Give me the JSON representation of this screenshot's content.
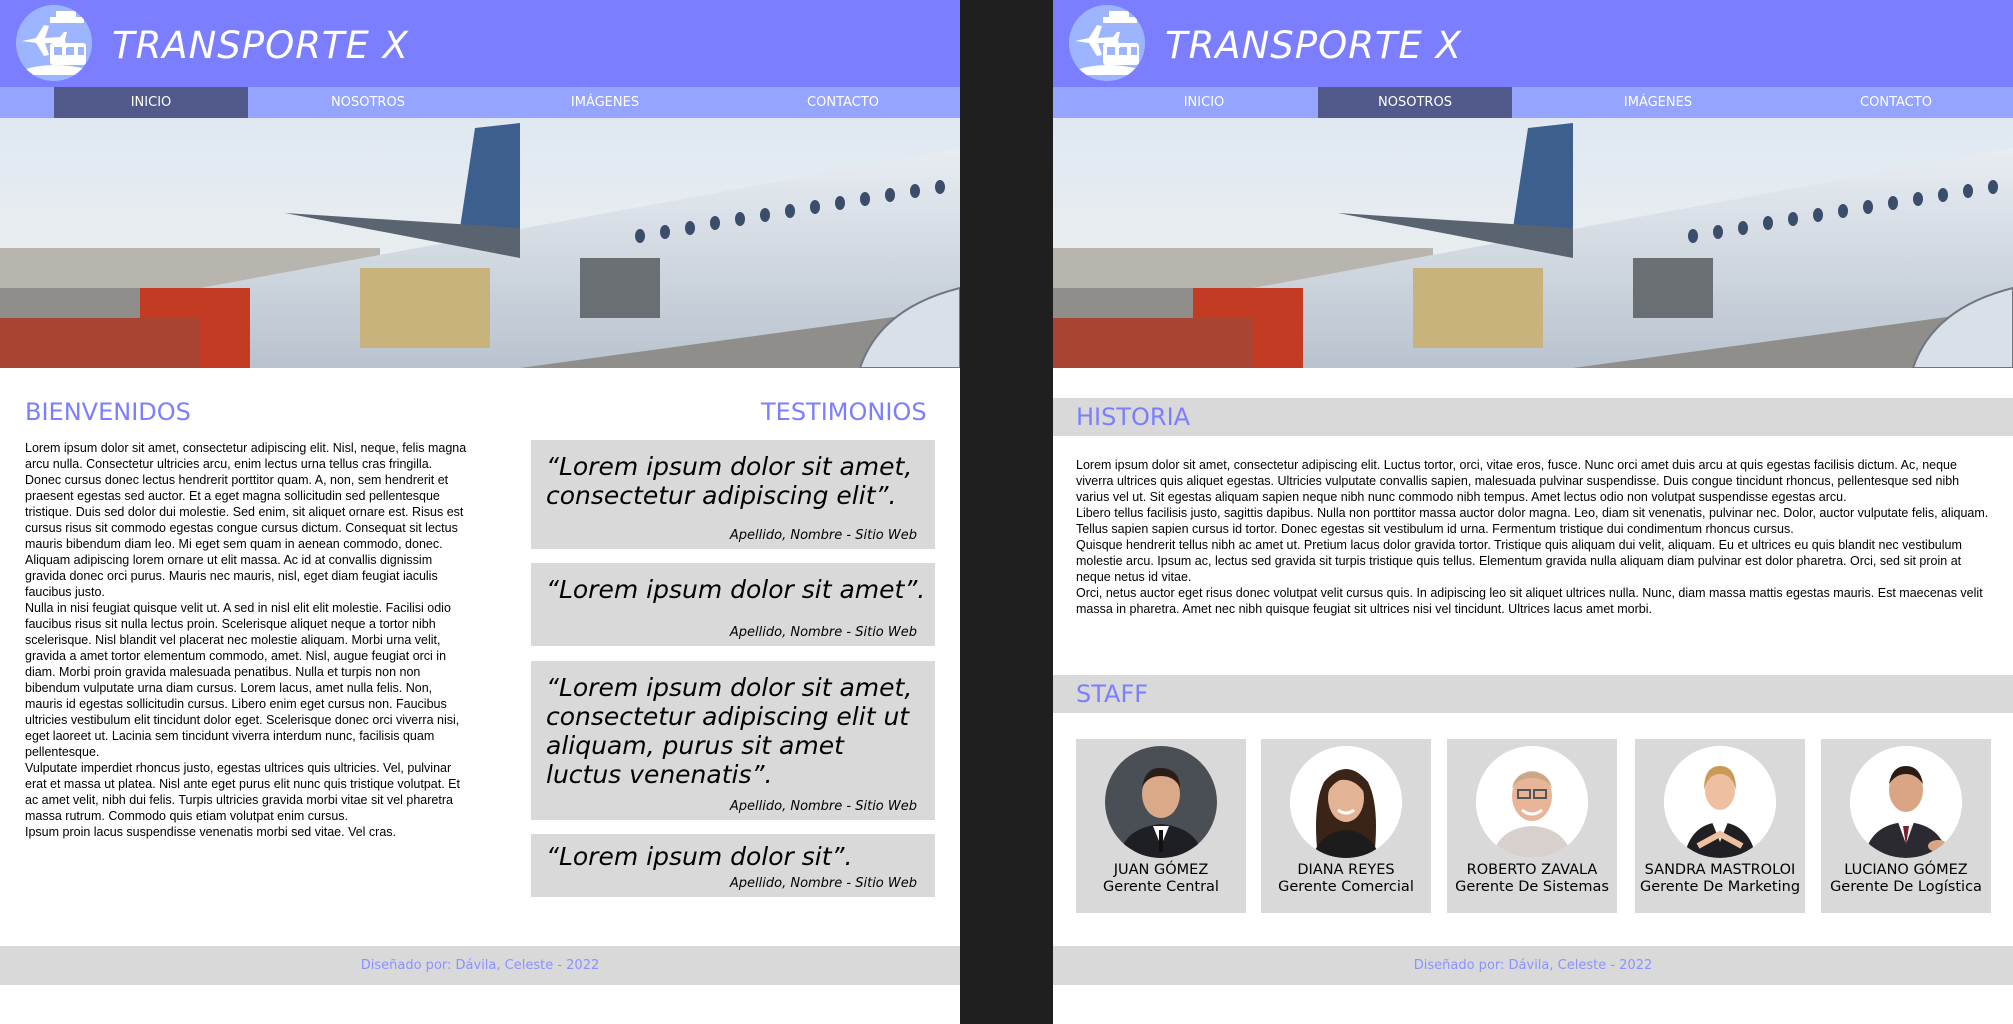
{
  "colors": {
    "header_bg": "#7b7fff",
    "nav_bg": "#95a4ff",
    "nav_active": "#525a8c",
    "heading": "#7b7fff",
    "panel_gray": "#d9d9d9",
    "footer_text": "#8b92ff",
    "outer_bg": "#1f1f1f"
  },
  "brand": {
    "title": "TRANSPORTE X",
    "logo_icon": "airplane-train-ship-icon"
  },
  "nav": {
    "items": [
      "INICIO",
      "NOSOTROS",
      "IMÁGENES",
      "CONTACTO"
    ]
  },
  "left_page": {
    "active_nav": "INICIO",
    "welcome": {
      "heading": "BIENVENIDOS",
      "paragraphs": [
        "Lorem ipsum dolor sit amet, consectetur adipiscing elit. Nisl, neque, felis magna arcu nulla. Consectetur ultricies arcu, enim lectus urna tellus cras fringilla. Donec cursus donec lectus hendrerit porttitor quam. A, non, sem hendrerit et praesent egestas sed auctor. Et a eget magna sollicitudin sed pellentesque tristique. Duis sed dolor dui molestie. Sed enim, sit aliquet ornare est. Risus est cursus risus sit commodo egestas congue cursus dictum. Consequat sit lectus mauris bibendum diam leo. Mi eget sem quam in aenean commodo, donec. Aliquam adipiscing lorem ornare ut elit massa. Ac id at convallis dignissim gravida donec orci purus. Mauris nec mauris, nisl, eget diam feugiat iaculis faucibus justo.",
        "Nulla in nisi feugiat quisque velit ut. A sed in nisl elit elit molestie. Facilisi odio faucibus risus sit nulla lectus proin. Scelerisque aliquet neque a tortor nibh scelerisque. Nisl blandit vel placerat nec molestie aliquam. Morbi urna velit, gravida a amet tortor elementum commodo, amet. Nisl, augue feugiat orci in diam. Morbi proin gravida malesuada penatibus. Nulla et turpis non non bibendum vulputate urna diam cursus. Lorem lacus, amet nulla felis. Non, mauris id egestas sollicitudin cursus. Libero enim eget cursus non. Faucibus ultricies vestibulum elit tincidunt dolor eget. Scelerisque donec orci viverra nisi, eget laoreet ut. Lacinia sem tincidunt viverra interdum nunc, facilisis quam pellentesque.",
        "Vulputate imperdiet rhoncus justo, egestas ultrices quis ultricies. Vel, pulvinar erat et massa ut platea. Nisl ante eget purus elit nunc quis tristique volutpat. Et ac amet velit, nibh dui felis. Turpis ultricies gravida morbi vitae sit vel pharetra massa rutrum. Commodo quis etiam volutpat enim cursus.",
        "Ipsum proin lacus suspendisse venenatis morbi sed vitae. Vel cras."
      ]
    },
    "testimonials": {
      "heading": "TESTIMONIOS",
      "items": [
        {
          "quote": "“Lorem ipsum dolor sit amet, consectetur adipiscing elit”.",
          "author": "Apellido, Nombre - Sitio Web"
        },
        {
          "quote": "“Lorem ipsum dolor sit amet”.",
          "author": "Apellido, Nombre - Sitio Web"
        },
        {
          "quote": "“Lorem ipsum dolor sit amet, consectetur adipiscing elit ut aliquam, purus sit amet luctus venenatis”.",
          "author": "Apellido, Nombre - Sitio Web"
        },
        {
          "quote": "“Lorem ipsum dolor sit”.",
          "author": "Apellido, Nombre - Sitio Web"
        }
      ]
    }
  },
  "right_page": {
    "active_nav": "NOSOTROS",
    "history": {
      "heading": "HISTORIA",
      "paragraphs": [
        "Lorem ipsum dolor sit amet, consectetur adipiscing elit. Luctus tortor, orci, vitae eros, fusce. Nunc orci amet duis arcu at quis egestas facilisis dictum. Ac, neque viverra ultrices quis aliquet egestas. Ultricies vulputate convallis sapien, malesuada pulvinar suspendisse. Duis congue tincidunt rhoncus, pellentesque sed nibh varius vel ut. Sit egestas aliquam sapien neque nibh nunc commodo nibh tempus. Amet lectus odio non volutpat suspendisse egestas arcu.",
        "Libero tellus facilisis justo, sagittis dapibus. Nulla non porttitor massa auctor dolor magna. Leo, diam sit venenatis, pulvinar nec. Dolor, auctor vulputate felis, aliquam. Tellus sapien sapien cursus id tortor. Donec egestas sit vestibulum id urna. Fermentum tristique dui condimentum rhoncus cursus.",
        "Quisque hendrerit tellus nibh ac amet ut. Pretium lacus dolor gravida tortor. Tristique quis aliquam dui velit, aliquam. Eu et ultrices eu quis blandit nec vestibulum molestie arcu. Ipsum ac, lectus sed gravida sit turpis tristique quis tellus. Elementum gravida nulla aliquam diam pulvinar est dolor pharetra. Orci, sed sit proin at neque netus id vitae.",
        "Orci, netus auctor eget risus donec volutpat velit cursus quis. In adipiscing leo sit aliquet ultrices nulla. Nunc, diam massa mattis egestas mauris. Est maecenas velit massa in pharetra. Amet nec nibh quisque feugiat sit ultrices nisi vel tincidunt. Ultrices lacus amet morbi."
      ]
    },
    "staff": {
      "heading": "STAFF",
      "members": [
        {
          "name": "JUAN GÓMEZ",
          "role": "Gerente Central"
        },
        {
          "name": "DIANA REYES",
          "role": "Gerente Comercial"
        },
        {
          "name": "ROBERTO ZAVALA",
          "role": "Gerente De Sistemas"
        },
        {
          "name": "SANDRA MASTROLOI",
          "role": "Gerente De Marketing"
        },
        {
          "name": "LUCIANO GÓMEZ",
          "role": "Gerente De Logística"
        }
      ]
    }
  },
  "footer": {
    "text": "Diseñado por: Dávila, Celeste - 2022"
  }
}
